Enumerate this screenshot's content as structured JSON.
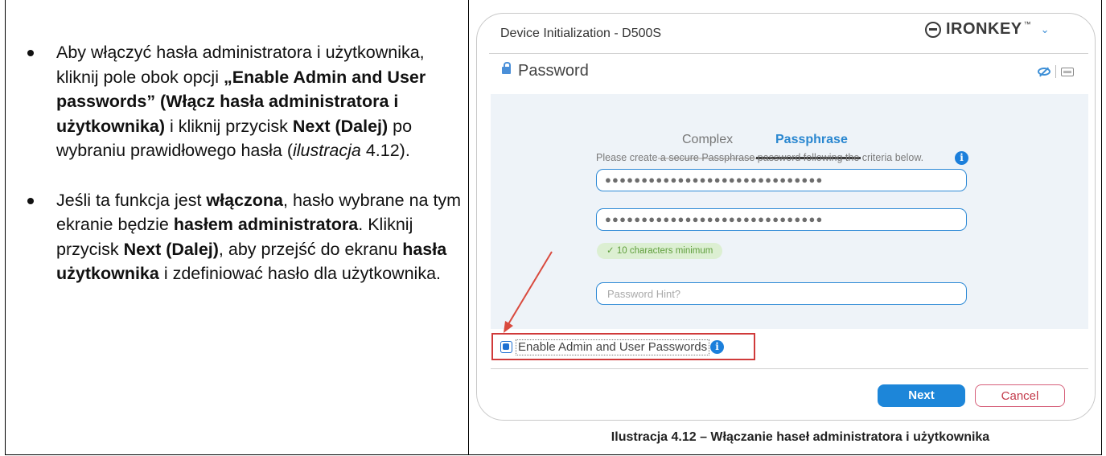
{
  "left_column": {
    "item1": {
      "p1": "Aby włączyć hasła administratora i użytkownika, kliknij pole obok opcji ",
      "b1": "„Enable Admin and User passwords” (Włącz hasła administratora i użytkownika)",
      "p2": " i kliknij przycisk ",
      "b2": "Next (Dalej)",
      "p3": " po wybraniu prawidłowego hasła (",
      "i1": "ilustracja",
      "p4": " 4.12)."
    },
    "item2": {
      "p1": "Jeśli ta funkcja jest ",
      "b1": "włączona",
      "p2": ", hasło wybrane na tym ekranie będzie ",
      "b2": "hasłem administratora",
      "p3": ". Kliknij przycisk ",
      "b3": "Next (Dalej)",
      "p4": ", aby przejść do ekranu ",
      "b4": "hasła użytkownika",
      "p5": " i zdefiniować hasło dla użytkownika."
    }
  },
  "dialog": {
    "title": "Device Initialization - D500S",
    "brand": "IRONKEY",
    "brand_tm": "™",
    "brand_chevron": "⌄",
    "section_title": "Password",
    "tabs": [
      "Complex",
      "Passphrase"
    ],
    "active_tab": "Passphrase",
    "instruction": "Please create a secure Passphrase password following the criteria below.",
    "info_glyph": "i",
    "password_dots": "●●●●●●●●●●●●●●●●●●●●●●●●●●●●●●",
    "confirm_dots": "●●●●●●●●●●●●●●●●●●●●●●●●●●●●●●",
    "requirement": "✓ 10 characters minimum",
    "hint_placeholder": "Password Hint?",
    "checkbox_label": "Enable Admin and User Passwords",
    "checkbox_checked": true,
    "next_label": "Next",
    "cancel_label": "Cancel",
    "colors": {
      "accent": "#1d86d9",
      "highlight": "#d03a3a",
      "cancel": "#c33a4a"
    }
  },
  "caption": "Ilustracja 4.12 – Włączanie haseł administratora i użytkownika"
}
